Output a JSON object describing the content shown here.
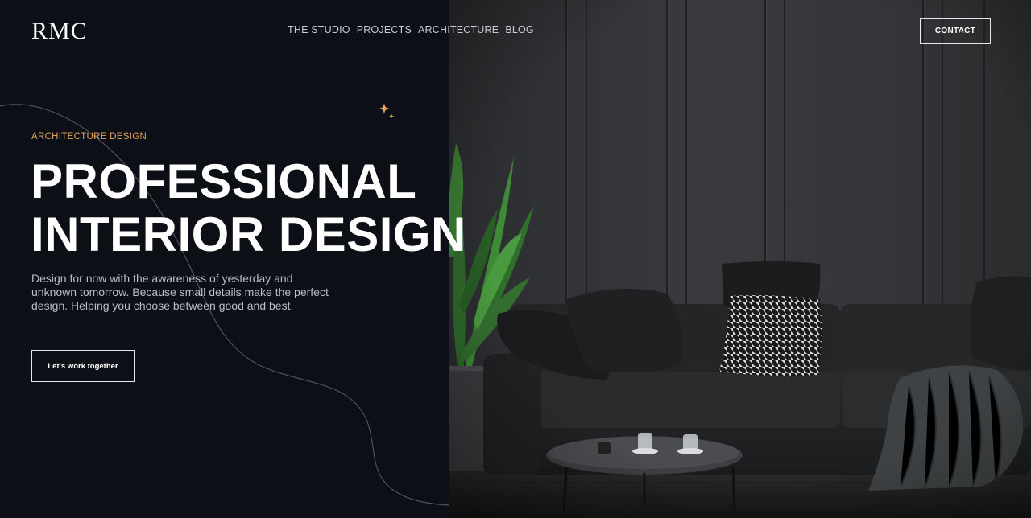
{
  "brand": {
    "logo_text": "RMC"
  },
  "nav": {
    "items": [
      {
        "label": "THE STUDIO"
      },
      {
        "label": "PROJECTS"
      },
      {
        "label": "ARCHITECTURE"
      },
      {
        "label": "BLOG"
      }
    ],
    "contact_label": "CONTACT"
  },
  "hero": {
    "eyebrow": "ARCHITECTURE DESIGN",
    "headline_line1": "PROFESSIONAL",
    "headline_line2": "INTERIOR DESIGN",
    "description": "Design for now with the awareness of yesterday and unknown tomorrow. Because small details make the perfect design. Helping you choose between good and best.",
    "cta_label": "Let's work together",
    "image_alt": "dark living room interior with sofa, plant and coffee table"
  },
  "colors": {
    "background": "#0d0f16",
    "accent": "#e2a560",
    "text_primary": "#ffffff",
    "text_muted": "#b9bcc6"
  },
  "icons": {
    "sparkle": "sparkle-icon"
  }
}
